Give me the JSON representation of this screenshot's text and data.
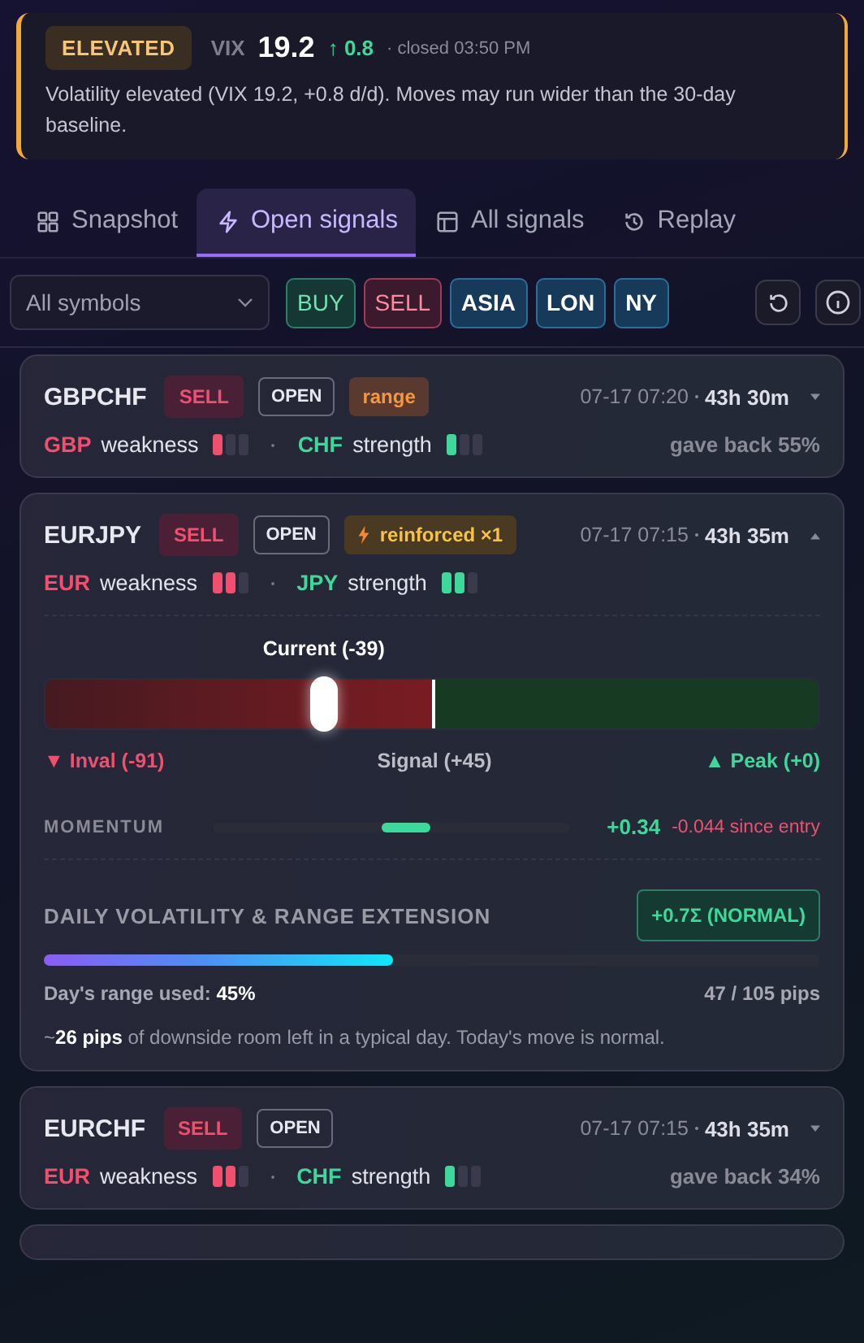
{
  "banner": {
    "level_label": "ELEVATED",
    "index": "VIX",
    "value": "19.2",
    "change_arrow": "↑",
    "change": "0.8",
    "closed": "· closed 03:50 PM",
    "message": "Volatility elevated (VIX 19.2, +0.8 d/d). Moves may run wider than the 30-day baseline."
  },
  "tabs": [
    {
      "label": "Snapshot",
      "selected": false
    },
    {
      "label": "Open signals",
      "selected": true
    },
    {
      "label": "All signals",
      "selected": false
    },
    {
      "label": "Replay",
      "selected": false
    }
  ],
  "filters": {
    "symbol_select": {
      "value": "All symbols"
    },
    "chips": [
      {
        "label": "BUY",
        "kind": "buy"
      },
      {
        "label": "SELL",
        "kind": "sell"
      },
      {
        "label": "ASIA",
        "kind": "session"
      },
      {
        "label": "LON",
        "kind": "session"
      },
      {
        "label": "NY",
        "kind": "session"
      }
    ]
  },
  "signals": [
    {
      "symbol": "GBPCHF",
      "side": "SELL",
      "status": "OPEN",
      "tag": {
        "kind": "range",
        "label": "range"
      },
      "time": "07-17 07:20",
      "age": "43h 30m",
      "expanded": false,
      "base": {
        "ccy": "GBP",
        "label": "weakness",
        "level": 0.33
      },
      "quote": {
        "ccy": "CHF",
        "label": "strength",
        "level": 0.33
      },
      "gave_back": "gave back 55%"
    },
    {
      "symbol": "EURJPY",
      "side": "SELL",
      "status": "OPEN",
      "tag": {
        "kind": "reinforced",
        "label": "reinforced ×1"
      },
      "time": "07-17 07:15",
      "age": "43h 35m",
      "expanded": true,
      "base": {
        "ccy": "EUR",
        "label": "weakness",
        "level": 0.67
      },
      "quote": {
        "ccy": "JPY",
        "label": "strength",
        "level": 0.67
      },
      "details": {
        "slider": {
          "current": "Current (-39)",
          "level": 0.36,
          "inval": "▼ Inval (-91)",
          "signal": "Signal (+45)",
          "peak": "▲ Peak (+0)"
        },
        "momentum": {
          "label": "MOMENTUM",
          "level": 0.54,
          "value": "+0.34",
          "since": "-0.044 since entry"
        },
        "volatility": {
          "title": "DAILY VOLATILITY & RANGE EXTENSION",
          "badge": "+0.7Σ (NORMAL)",
          "level": 0.45,
          "used": "Day's range used: **45%**",
          "pips": "47 / 105 pips",
          "note": "~**26 pips** of downside room left in a typical day. Today's move is normal."
        }
      }
    },
    {
      "symbol": "EURCHF",
      "side": "SELL",
      "status": "OPEN",
      "time": "07-17 07:15",
      "age": "43h 35m",
      "expanded": false,
      "base": {
        "ccy": "EUR",
        "label": "weakness",
        "level": 0.67
      },
      "quote": {
        "ccy": "CHF",
        "label": "strength",
        "level": 0.33
      },
      "gave_back": "gave back 34%"
    }
  ]
}
